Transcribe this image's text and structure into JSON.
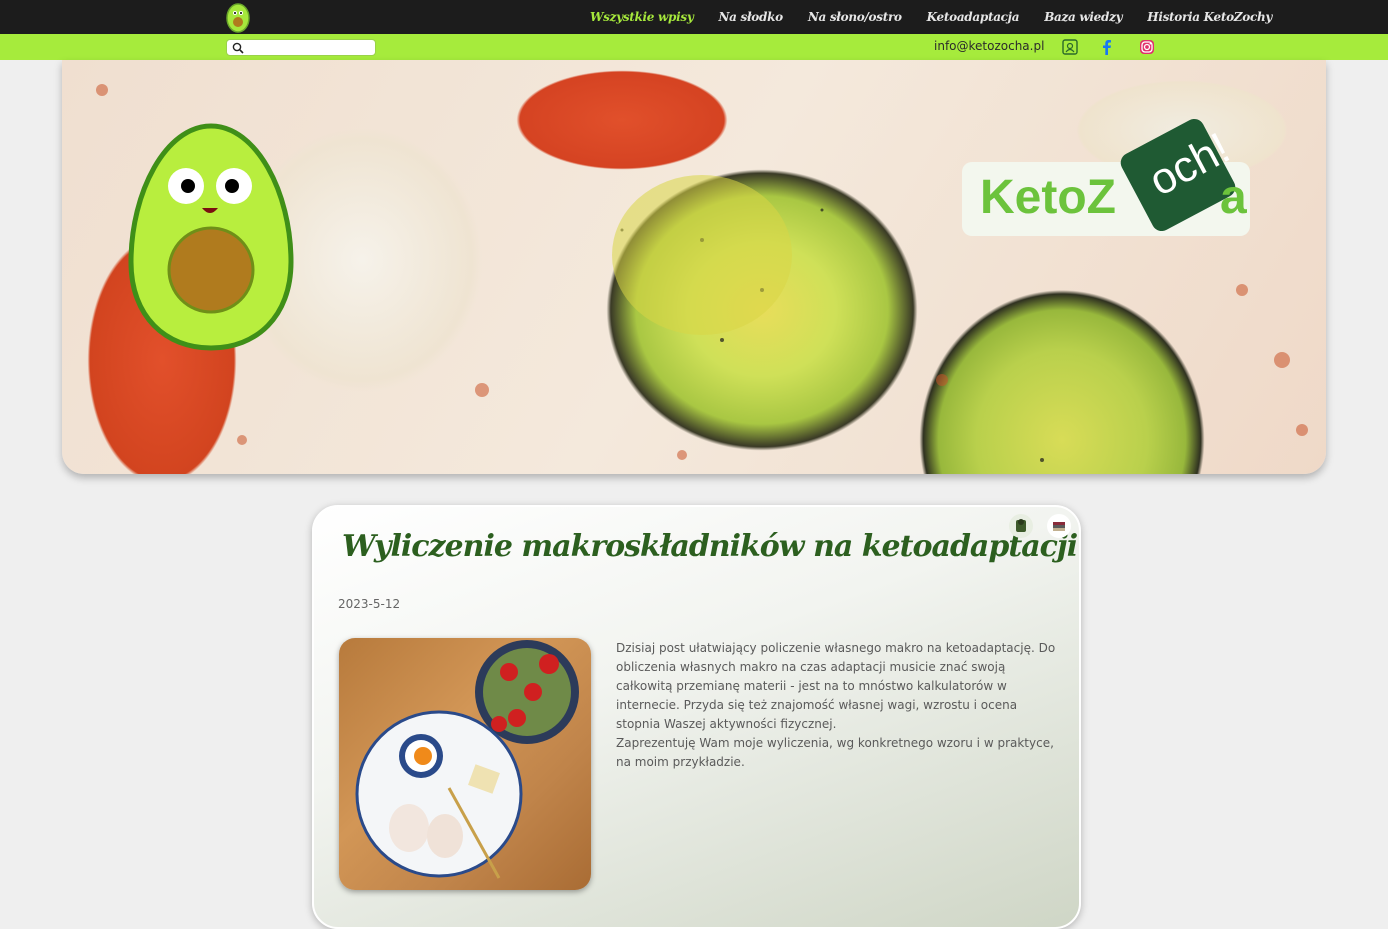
{
  "nav": {
    "items": [
      {
        "label": "Wszystkie wpisy",
        "active": true
      },
      {
        "label": "Na słodko"
      },
      {
        "label": "Na słono/ostro"
      },
      {
        "label": "Ketoadaptacja"
      },
      {
        "label": "Baza wiedzy"
      },
      {
        "label": "Historia KetoZochy"
      }
    ]
  },
  "subbar": {
    "search_placeholder": "",
    "email": "info@ketozocha.pl",
    "icons": [
      "contact-book-icon",
      "facebook-icon",
      "instagram-icon"
    ]
  },
  "hero": {
    "brand_word": "KetoZ",
    "brand_tag": "och!",
    "brand_end": "a"
  },
  "article": {
    "title": "Wyliczenie makroskładników na ketoadaptacji #BTW",
    "date": "2023-5-12",
    "paragraph1": "Dzisiaj post ułatwiający policzenie własnego makro na ketoadaptację. Do obliczenia własnych makro na czas adaptacji musicie znać swoją całkowitą przemianę materii - jest na to mnóstwo kalkulatorów w internecie. Przyda się też znajomość własnej wagi, wzrostu i ocena stopnia Waszej aktywności fizycznej.",
    "paragraph2": "Zaprezentuję Wam moje wyliczenia, wg konkretnego wzoru i w praktyce, na moim przykładzie."
  },
  "colors": {
    "accent_green": "#a6eb3c",
    "title_green": "#2c5f1f",
    "topbar": "#1c1c1c"
  }
}
